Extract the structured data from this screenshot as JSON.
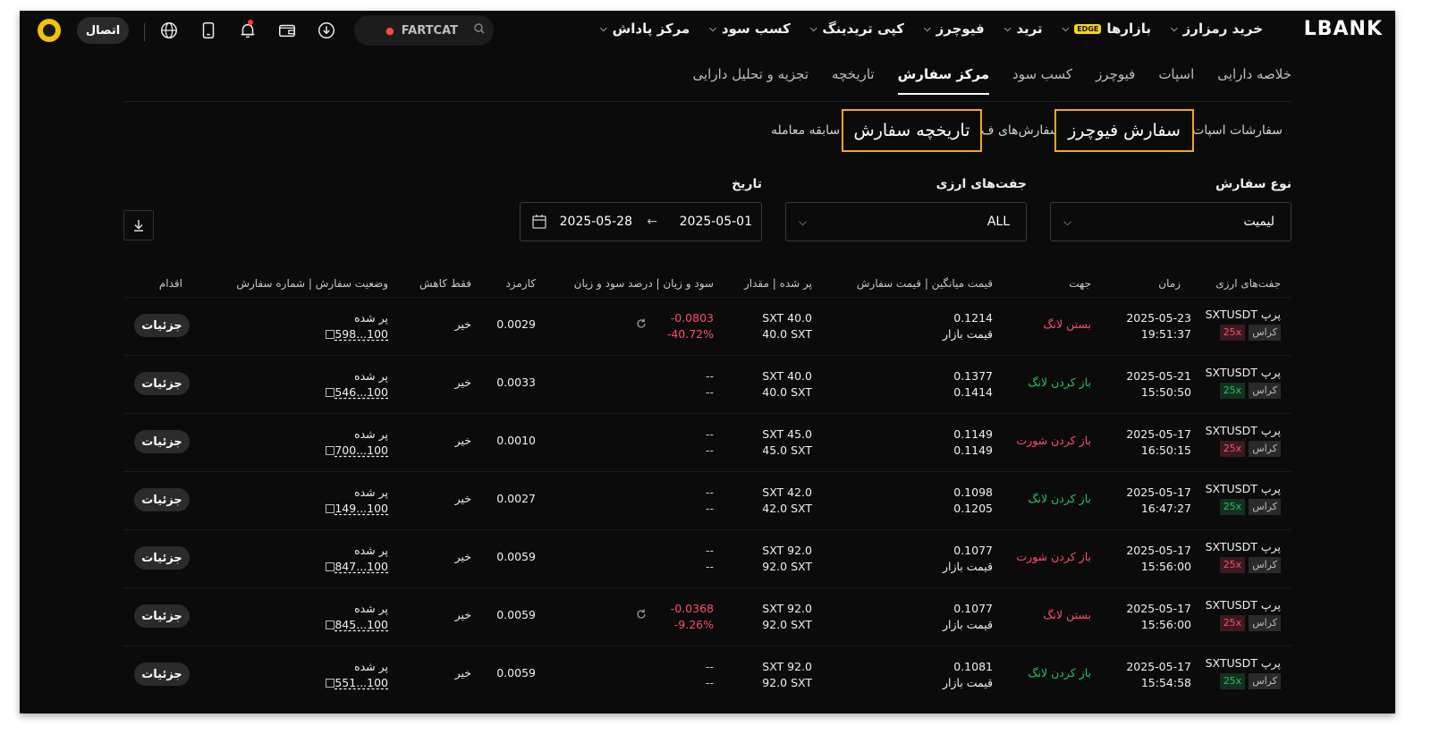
{
  "brand": {
    "logo_text": "LBANK"
  },
  "topbar": {
    "nav": [
      {
        "label": "خرید رمزارز"
      },
      {
        "label": "بازارها",
        "badge": "EDGE"
      },
      {
        "label": "ترید"
      },
      {
        "label": "فیوچرز"
      },
      {
        "label": "کپی تریدینگ"
      },
      {
        "label": "کسب سود"
      },
      {
        "label": "مرکز پاداش"
      }
    ],
    "search_text": "FARTCAT",
    "connect_label": "اتصال",
    "icons": [
      "search-icon",
      "flame-icon",
      "download-icon",
      "wallet-icon",
      "bell-icon",
      "device-icon",
      "globe-icon",
      "avatar"
    ]
  },
  "tabs": [
    {
      "label": "خلاصه دارایی"
    },
    {
      "label": "اسپات"
    },
    {
      "label": "فیوچرز"
    },
    {
      "label": "کسب سود"
    },
    {
      "label": "مرکز سفارش",
      "active": true
    },
    {
      "label": "تاریخچه"
    },
    {
      "label": "تجزیه و تحلیل دارایی"
    }
  ],
  "subtabs": {
    "spot_orders": "سفارشات اسپات",
    "futures_orders_partial": "سفارش‌های ف",
    "trade_history_partial": "سابقه معامله",
    "highlight_futures": "سفارش فیوچرز",
    "highlight_history": "تاریخچه سفارش"
  },
  "filters": {
    "order_type_label": "نوع سفارش",
    "order_type_value": "لیمیت",
    "pairs_label": "جفت‌های ارزی",
    "pairs_value": "ALL",
    "date_label": "تاریخ",
    "date_from": "2025-05-01",
    "date_to": "2025-05-28",
    "arrow": "←"
  },
  "table": {
    "headers": {
      "pair": "جفت‌های ارزی",
      "time": "زمان",
      "side": "جهت",
      "price": "قیمت میانگین | قیمت سفارش",
      "filled": "پر شده | مقدار",
      "pnl": "سود و زیان | درصد سود و زیان",
      "fee": "کارمزد",
      "reduce": "فقط کاهش",
      "status": "وضعیت سفارش | شماره سفارش",
      "action": "اقدام"
    },
    "rows": [
      {
        "pair": "SXTUSDT پرپ",
        "margin": "کراس",
        "lev": "25x",
        "lev_color": "red",
        "date": "2025-05-23",
        "clock": "19:51:37",
        "side": "بستن لانگ",
        "side_color": "red",
        "avg": "0.1214",
        "order_price": "قیمت بازار",
        "filled": "SXT 40.0",
        "qty": "40.0 SXT",
        "pnl": "-0.0803",
        "pnl_pct": "-40.72%",
        "has_share": true,
        "fee": "0.0029",
        "reduce": "خیر",
        "status": "پر شده",
        "order_no": "598...100",
        "action": "جزئیات"
      },
      {
        "pair": "SXTUSDT پرپ",
        "margin": "کراس",
        "lev": "25x",
        "lev_color": "green",
        "date": "2025-05-21",
        "clock": "15:50:50",
        "side": "باز کردن لانگ",
        "side_color": "green",
        "avg": "0.1377",
        "order_price": "0.1414",
        "filled": "SXT 40.0",
        "qty": "40.0 SXT",
        "pnl": "--",
        "pnl_pct": "--",
        "has_share": false,
        "fee": "0.0033",
        "reduce": "خیر",
        "status": "پر شده",
        "order_no": "546...100",
        "action": "جزئیات"
      },
      {
        "pair": "SXTUSDT پرپ",
        "margin": "کراس",
        "lev": "25x",
        "lev_color": "red",
        "date": "2025-05-17",
        "clock": "16:50:15",
        "side": "باز کردن شورت",
        "side_color": "red",
        "avg": "0.1149",
        "order_price": "0.1149",
        "filled": "SXT 45.0",
        "qty": "45.0 SXT",
        "pnl": "--",
        "pnl_pct": "--",
        "has_share": false,
        "fee": "0.0010",
        "reduce": "خیر",
        "status": "پر شده",
        "order_no": "700...100",
        "action": "جزئیات"
      },
      {
        "pair": "SXTUSDT پرپ",
        "margin": "کراس",
        "lev": "25x",
        "lev_color": "green",
        "date": "2025-05-17",
        "clock": "16:47:27",
        "side": "باز کردن لانگ",
        "side_color": "green",
        "avg": "0.1098",
        "order_price": "0.1205",
        "filled": "SXT 42.0",
        "qty": "42.0 SXT",
        "pnl": "--",
        "pnl_pct": "--",
        "has_share": false,
        "fee": "0.0027",
        "reduce": "خیر",
        "status": "پر شده",
        "order_no": "149...100",
        "action": "جزئیات"
      },
      {
        "pair": "SXTUSDT پرپ",
        "margin": "کراس",
        "lev": "25x",
        "lev_color": "red",
        "date": "2025-05-17",
        "clock": "15:56:00",
        "side": "باز کردن شورت",
        "side_color": "red",
        "avg": "0.1077",
        "order_price": "قیمت بازار",
        "filled": "SXT 92.0",
        "qty": "92.0 SXT",
        "pnl": "--",
        "pnl_pct": "--",
        "has_share": false,
        "fee": "0.0059",
        "reduce": "خیر",
        "status": "پر شده",
        "order_no": "847...100",
        "action": "جزئیات"
      },
      {
        "pair": "SXTUSDT پرپ",
        "margin": "کراس",
        "lev": "25x",
        "lev_color": "red",
        "date": "2025-05-17",
        "clock": "15:56:00",
        "side": "بستن لانگ",
        "side_color": "red",
        "avg": "0.1077",
        "order_price": "قیمت بازار",
        "filled": "SXT 92.0",
        "qty": "92.0 SXT",
        "pnl": "-0.0368",
        "pnl_pct": "-9.26%",
        "has_share": true,
        "fee": "0.0059",
        "reduce": "خیر",
        "status": "پر شده",
        "order_no": "845...100",
        "action": "جزئیات"
      },
      {
        "pair": "SXTUSDT پرپ",
        "margin": "کراس",
        "lev": "25x",
        "lev_color": "green",
        "date": "2025-05-17",
        "clock": "15:54:58",
        "side": "باز کردن لانگ",
        "side_color": "green",
        "avg": "0.1081",
        "order_price": "قیمت بازار",
        "filled": "SXT 92.0",
        "qty": "92.0 SXT",
        "pnl": "--",
        "pnl_pct": "--",
        "has_share": false,
        "fee": "0.0059",
        "reduce": "خیر",
        "status": "پر شده",
        "order_no": "551...100",
        "action": "جزئیات"
      }
    ]
  },
  "colors": {
    "background": "#0b0b0b",
    "green": "#22c55e",
    "red": "#ff4d6a",
    "highlight": "#f5a623",
    "edge_badge": "#f5d90a"
  }
}
